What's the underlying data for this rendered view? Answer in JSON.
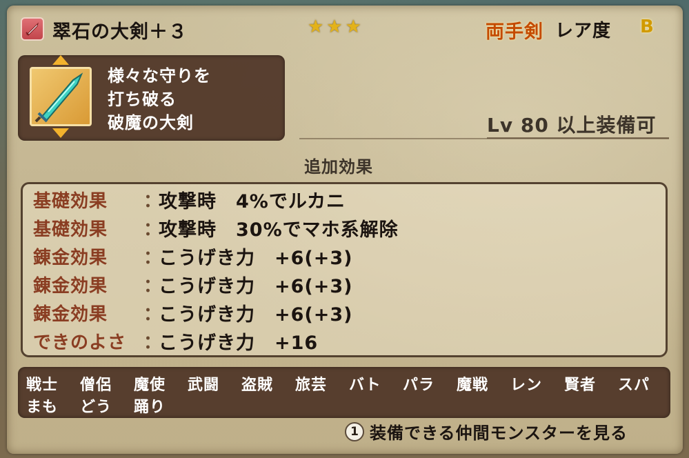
{
  "item": {
    "name": "翠石の大剣＋３",
    "stars": "★★★",
    "category": "両手剣",
    "rarity_label": "レア度",
    "rarity_value": "B",
    "icon": "sword-category-icon"
  },
  "description": {
    "lines": [
      "様々な守りを",
      "打ち破る",
      "破魔の大剣"
    ],
    "thumbnail_icon": "great-sword-icon"
  },
  "requirement": {
    "level_text": "Lv 80 以上装備可"
  },
  "extra_effects": {
    "title": "追加効果",
    "separator": "：",
    "rows": [
      {
        "label": "基礎効果",
        "value": "攻撃時　4%でルカニ"
      },
      {
        "label": "基礎効果",
        "value": "攻撃時　30%でマホ系解除"
      },
      {
        "label": "錬金効果",
        "value": "こうげき力　+6(+3)"
      },
      {
        "label": "錬金効果",
        "value": "こうげき力　+6(+3)"
      },
      {
        "label": "錬金効果",
        "value": "こうげき力　+6(+3)"
      },
      {
        "label": "できのよさ",
        "value": "こうげき力　+16"
      }
    ]
  },
  "jobs": {
    "row1": [
      "戦士",
      "僧侶",
      "魔使",
      "武闘",
      "盗賊",
      "旅芸",
      "バト",
      "パラ",
      "魔戦",
      "レン",
      "賢者",
      "スパ"
    ],
    "row2": [
      "まも",
      "どう",
      "踊り"
    ]
  },
  "footer": {
    "button_label": "1",
    "text": "装備できる仲間モンスターを見る"
  },
  "colors": {
    "category": "#c44a00",
    "rarity": "#d19a00",
    "stars": "#e3b21a",
    "effect_label": "#8a3d22"
  }
}
